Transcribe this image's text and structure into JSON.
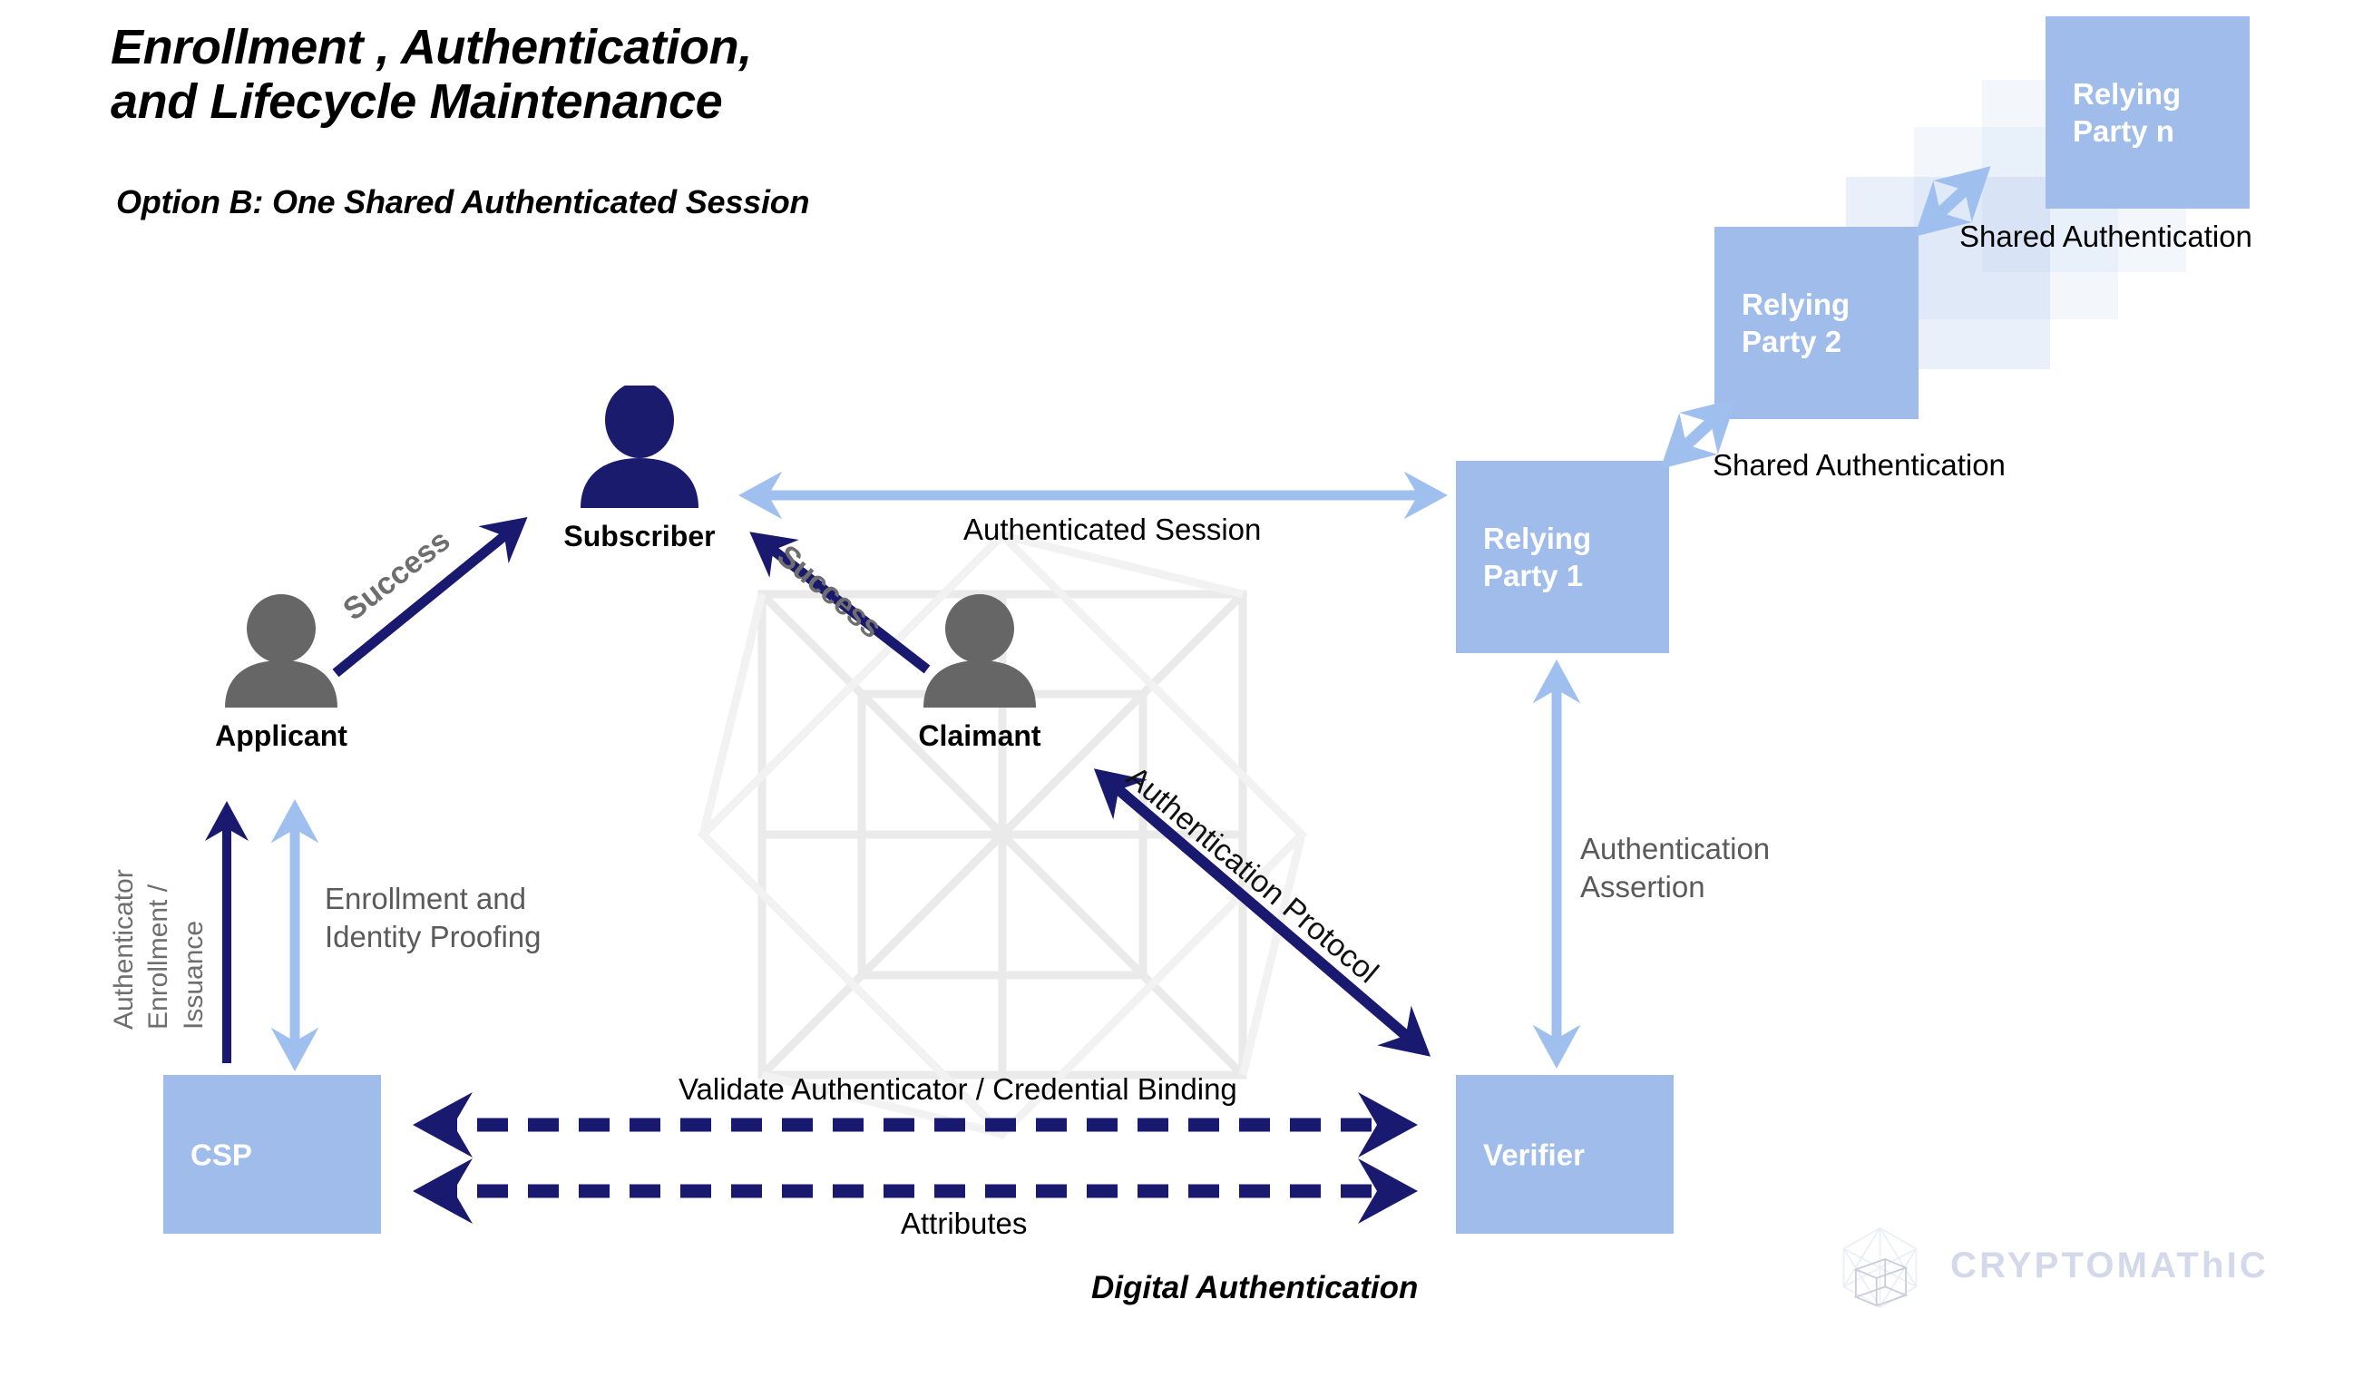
{
  "header": {
    "title": "Enrollment ,  Authentication,\nand Lifecycle Maintenance",
    "subtitle": "Option B: One Shared Authenticated Session"
  },
  "footer": {
    "caption": "Digital Authentication",
    "brand": "CRYPTOMAThIC"
  },
  "colors": {
    "box_blue": "#9fbcea",
    "arrow_light_blue": "#9fc0ee",
    "arrow_navy": "#191970",
    "label_gray": "#5a5a5a",
    "person_gray": "#666666",
    "person_navy": "#1b1b6e",
    "watermark_gray": "#eaeaea",
    "brand_gray": "#d3d9ea",
    "text_black": "#000000"
  },
  "actors": [
    {
      "id": "applicant",
      "label": "Applicant",
      "icon": "person-icon",
      "color": "gray"
    },
    {
      "id": "subscriber",
      "label": "Subscriber",
      "icon": "person-icon",
      "color": "navy"
    },
    {
      "id": "claimant",
      "label": "Claimant",
      "icon": "person-icon",
      "color": "gray"
    }
  ],
  "boxes": [
    {
      "id": "rp-n",
      "label": "Relying\nParty n",
      "state": "solid"
    },
    {
      "id": "rp-g1",
      "label": "",
      "state": "ghost"
    },
    {
      "id": "rp-g2",
      "label": "",
      "state": "ghost"
    },
    {
      "id": "rp-g3",
      "label": "",
      "state": "ghost"
    },
    {
      "id": "rp-2",
      "label": "Relying\nParty 2",
      "state": "solid"
    },
    {
      "id": "rp-1",
      "label": "Relying\nParty 1",
      "state": "solid"
    },
    {
      "id": "csp",
      "label": "CSP",
      "state": "solid"
    },
    {
      "id": "verifier",
      "label": "Verifier",
      "state": "solid"
    }
  ],
  "edges": [
    {
      "id": "success-1",
      "label": "Success",
      "style": "solid-navy",
      "heads": "single",
      "from": "applicant",
      "to": "subscriber"
    },
    {
      "id": "success-2",
      "label": "Success",
      "style": "solid-navy",
      "heads": "single",
      "from": "claimant",
      "to": "subscriber"
    },
    {
      "id": "auth-protocol",
      "label": "Authentication Protocol",
      "style": "solid-navy",
      "heads": "double",
      "from": "claimant",
      "to": "verifier"
    },
    {
      "id": "auth-session",
      "label": "Authenticated Session",
      "style": "solid-light",
      "heads": "double",
      "from": "subscriber",
      "to": "rp-1"
    },
    {
      "id": "shared-auth-1",
      "label": "Shared Authentication",
      "style": "solid-light",
      "heads": "double",
      "from": "rp-1",
      "to": "rp-2"
    },
    {
      "id": "shared-auth-2",
      "label": "Shared Authentication",
      "style": "solid-light",
      "heads": "double",
      "from": "rp-2",
      "to": "rp-n"
    },
    {
      "id": "auth-assertion",
      "label": "Authentication\nAssertion",
      "style": "solid-light",
      "heads": "double",
      "from": "verifier",
      "to": "rp-1"
    },
    {
      "id": "enrollment",
      "label": "Enrollment and\nIdentity Proofing",
      "style": "solid-light",
      "heads": "double",
      "from": "csp",
      "to": "applicant"
    },
    {
      "id": "authenticator",
      "label": "Authenticator\nEnrollment /\nIssuance",
      "style": "solid-navy",
      "heads": "single",
      "from": "csp",
      "to": "applicant"
    },
    {
      "id": "validate-binding",
      "label": "Validate Authenticator / Credential Binding",
      "style": "dashed-navy",
      "heads": "double",
      "from": "csp",
      "to": "verifier"
    },
    {
      "id": "attributes",
      "label": "Attributes",
      "style": "dashed-navy",
      "heads": "double",
      "from": "csp",
      "to": "verifier"
    }
  ]
}
